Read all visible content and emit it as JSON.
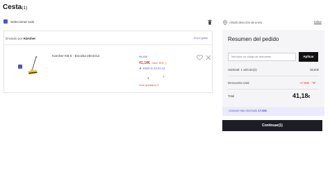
{
  "page": {
    "title": "Cesta",
    "count": "(1)"
  },
  "cart": {
    "select_all_label": "Seleccionar todo",
    "shipping_label": "Enviado por",
    "seller": "Kärcher",
    "free_shipping": "Envío gratis",
    "item": {
      "name": "Karcher KB 5 - Escoba electrica",
      "old_price": "58,83€",
      "new_price": "41,18€",
      "save_text": "Save 30% ⓘ",
      "ends_text": "Ends in 23:21:14",
      "quantity": "1",
      "stock_text": "Solo queda(n) 9"
    }
  },
  "address": {
    "label": "Añadir dirección de envío",
    "edit_label": "Editar"
  },
  "summary": {
    "title": "Resumen del pedido",
    "coupon_placeholder": "Introduce un código de descuento",
    "apply_label": "Aplicar",
    "subtotal_label": "Subtotal: 1 artículo(s)",
    "subtotal_value": "58,83€",
    "discount_label": "Descuento total",
    "discount_value": "-17,65€",
    "total_label": "Total",
    "total_value": "41,18",
    "total_unit": "€",
    "saved_text": "¡Genial! Has ahorrado",
    "saved_amount": "17,65€",
    "continue_label": "Continuar(1)"
  },
  "colors": {
    "accent": "#4b56c7",
    "discount": "#e53935",
    "dark_button": "#1d1d24",
    "saved_bg": "#ebeaff"
  },
  "icons": [
    "checkbox-checked-icon",
    "trash-icon",
    "location-pin-icon",
    "heart-icon",
    "close-icon",
    "lightning-icon",
    "chevron-down-icon"
  ]
}
